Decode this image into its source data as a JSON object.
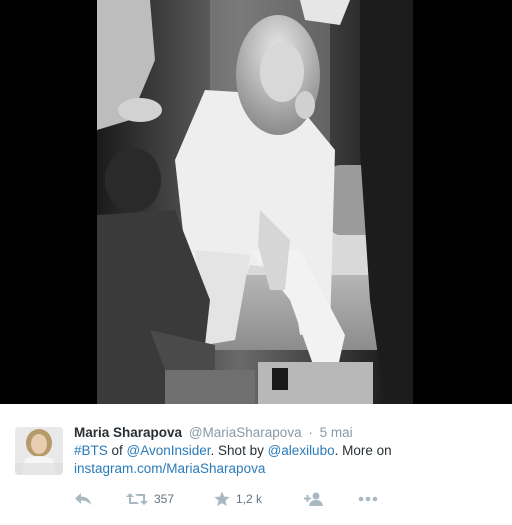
{
  "tweet": {
    "author_name": "Maria Sharapova",
    "author_handle": "@MariaSharapova",
    "separator": "·",
    "timestamp": "5 mai",
    "text": {
      "hashtag": "#BTS",
      "t1": " of ",
      "mention1": "@AvonInsider",
      "t2": ". Shot by ",
      "mention2": "@alexilubo",
      "t3": ". More on",
      "link": "instagram.com/MariaSharapova"
    }
  },
  "actions": {
    "reply_icon": "reply-icon",
    "retweet_icon": "retweet-icon",
    "retweet_count": "357",
    "like_icon": "star-icon",
    "like_count": "1,2 k",
    "follow_icon": "follow-icon",
    "more_icon": "more-icon"
  },
  "colors": {
    "name": "#292f33",
    "secondary": "#8899a6",
    "link": "#2b7bb9",
    "icon": "#8899a6"
  }
}
